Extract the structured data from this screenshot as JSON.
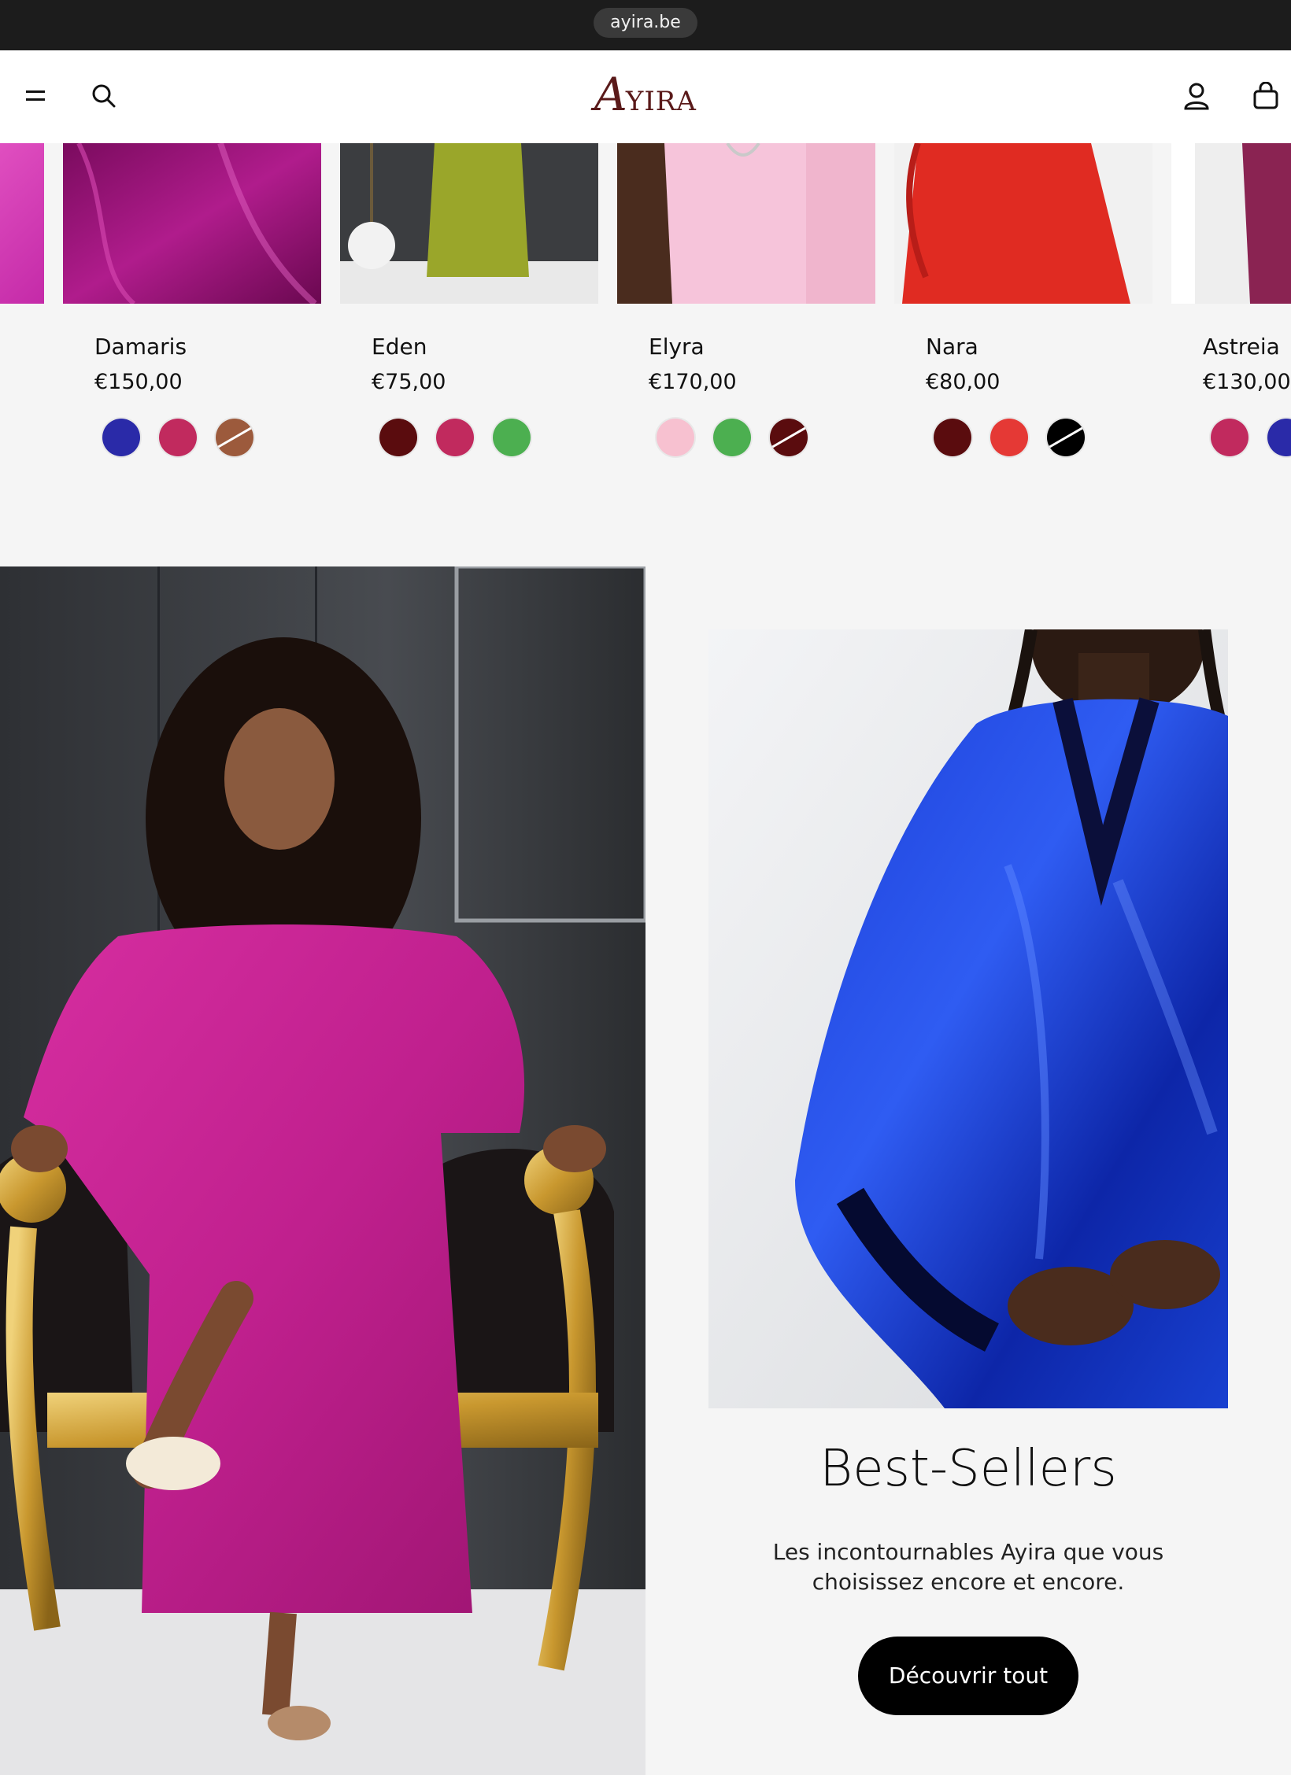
{
  "browser": {
    "url": "ayira.be"
  },
  "header": {
    "logo_initial": "A",
    "logo_rest": "YIRA",
    "icons": [
      "menu-icon",
      "search-icon",
      "account-icon",
      "cart-icon"
    ]
  },
  "products": [
    {
      "name": "Damaris",
      "price": "€150,00",
      "swatches": [
        "#2a2aa8",
        "#c12a5e",
        "#9c5a3c"
      ]
    },
    {
      "name": "Eden",
      "price": "€75,00",
      "swatches": [
        "#5a0c0e",
        "#c12a5e",
        "#4caf50"
      ]
    },
    {
      "name": "Elyra",
      "price": "€170,00",
      "swatches": [
        "#f7c1d0",
        "#4caf50",
        "#5a0c0e"
      ]
    },
    {
      "name": "Nara",
      "price": "€80,00",
      "swatches": [
        "#5a0c0e",
        "#e53935",
        "#000000"
      ]
    },
    {
      "name": "Astreia",
      "price": "€130,00",
      "swatches": [
        "#c12a5e",
        "#2a2aa8"
      ]
    }
  ],
  "bestsellers": {
    "title": "Best-Sellers",
    "description_line1": "Les incontournables Ayira que vous",
    "description_line2": "choisissez encore et encore.",
    "button_label": "Découvrir tout"
  }
}
